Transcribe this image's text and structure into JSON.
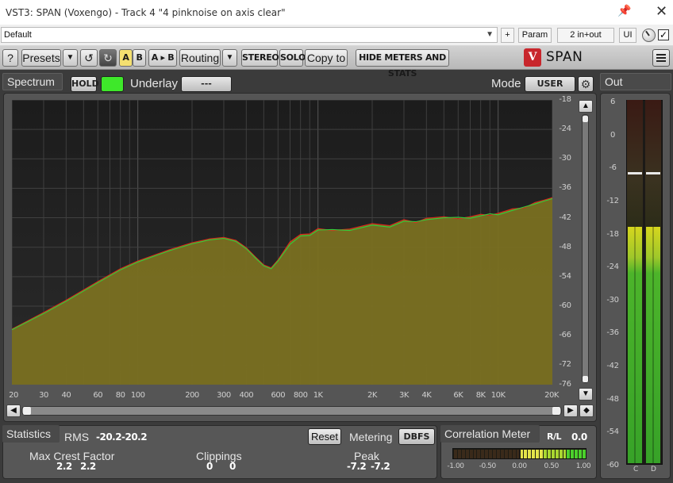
{
  "window": {
    "title": "VST3: SPAN (Voxengo) - Track 4 \"4 pinknoise on axis clear\""
  },
  "host": {
    "preset_value": "Default",
    "plus_label": "+",
    "param_label": "Param",
    "io_label": "2 in+out",
    "ui_label": "UI",
    "checkbox_mark": "✓"
  },
  "toolbar": {
    "help": "?",
    "presets": "Presets",
    "a": "A",
    "b": "B",
    "a_to_b": "A ▸ B",
    "routing": "Routing",
    "stereo": "STEREO",
    "solo": "SOLO",
    "copy_to": "Copy to",
    "hide_meters": "HIDE METERS AND STATS",
    "logo_glyph": "V",
    "logo_text": "SPAN",
    "active_color": "#f4e070"
  },
  "spectrum": {
    "panel_label": "Spectrum",
    "hold_label": "HOLD",
    "hold_indicator_color": "#3ee82a",
    "underlay_label": "Underlay",
    "underlay_value": "---",
    "mode_label": "Mode",
    "mode_value": "USER",
    "db_labels": [
      "-18",
      "-24",
      "-30",
      "-36",
      "-42",
      "-48",
      "-54",
      "-60",
      "-66",
      "-72",
      "-76"
    ],
    "hz_labels": [
      "20",
      "30",
      "40",
      "60",
      "80",
      "100",
      "200",
      "300",
      "400",
      "600",
      "800",
      "1K",
      "2K",
      "3K",
      "4K",
      "6K",
      "8K",
      "10K",
      "20K"
    ],
    "fill_color": "#7a7021",
    "line_colors": [
      "#2fd13a",
      "#d52a1c"
    ]
  },
  "chart_data": {
    "type": "area",
    "title": "",
    "xlabel": "",
    "ylabel": "",
    "x_scale": "log",
    "xlim": [
      20,
      20000
    ],
    "ylim": [
      -76,
      -18
    ],
    "grid": true,
    "x": [
      20,
      30,
      40,
      60,
      80,
      100,
      150,
      200,
      250,
      300,
      350,
      400,
      450,
      500,
      550,
      600,
      700,
      800,
      900,
      1000,
      1200,
      1500,
      2000,
      2500,
      3000,
      3500,
      4000,
      5000,
      6000,
      7000,
      8000,
      9000,
      10000,
      12000,
      14000,
      16000,
      18000,
      20000
    ],
    "series": [
      {
        "values": [
          -64.8,
          -61.5,
          -59.0,
          -55.2,
          -52.6,
          -51.0,
          -48.7,
          -47.3,
          -46.5,
          -46.2,
          -46.8,
          -48.3,
          -50.2,
          -51.8,
          -52.4,
          -50.8,
          -47.4,
          -45.7,
          -45.6,
          -44.5,
          -44.4,
          -44.6,
          -43.5,
          -43.9,
          -42.7,
          -42.8,
          -42.4,
          -42.0,
          -41.9,
          -42.1,
          -41.6,
          -41.2,
          -41.4,
          -40.5,
          -39.8,
          -39.2,
          -38.6,
          -38.1
        ]
      },
      {
        "values": [
          -64.7,
          -61.3,
          -58.8,
          -55.0,
          -52.4,
          -50.8,
          -48.5,
          -47.1,
          -46.3,
          -46.0,
          -46.6,
          -48.1,
          -50.0,
          -51.6,
          -52.2,
          -50.6,
          -46.9,
          -45.4,
          -45.3,
          -44.2,
          -44.6,
          -44.3,
          -43.2,
          -43.6,
          -42.4,
          -43.0,
          -42.1,
          -41.8,
          -42.2,
          -41.8,
          -41.3,
          -41.5,
          -41.1,
          -40.2,
          -40.0,
          -38.9,
          -38.4,
          -37.9
        ]
      }
    ]
  },
  "out_meter": {
    "panel_label": "Out",
    "db_labels": [
      "6",
      "0",
      "-6",
      "-12",
      "-18",
      "-24",
      "-30",
      "-36",
      "-42",
      "-48",
      "-54",
      "-60"
    ],
    "channel_labels": [
      "C",
      "D"
    ],
    "level_db": [
      -17.0,
      -17.0
    ],
    "peak_hold_db": [
      -7.2,
      -7.2
    ],
    "range_db": [
      -60,
      6
    ]
  },
  "statistics": {
    "panel_label": "Statistics",
    "rms_label": "RMS",
    "rms_values": [
      "-20.2",
      "-20.2"
    ],
    "reset_label": "Reset",
    "metering_label": "Metering",
    "metering_value": "DBFS",
    "crest_label": "Max Crest Factor",
    "crest_values": [
      "2.2",
      "2.2"
    ],
    "clippings_label": "Clippings",
    "clippings_values": [
      "0",
      "0"
    ],
    "peak_label": "Peak",
    "peak_values": [
      "-7.2",
      "-7.2"
    ]
  },
  "correlation": {
    "panel_label": "Correlation Meter",
    "rl_label": "R/L",
    "rl_value": "0.0",
    "ticks": [
      "-1.00",
      "-0.50",
      "0.00",
      "0.50",
      "1.00"
    ],
    "value": 1.0
  }
}
